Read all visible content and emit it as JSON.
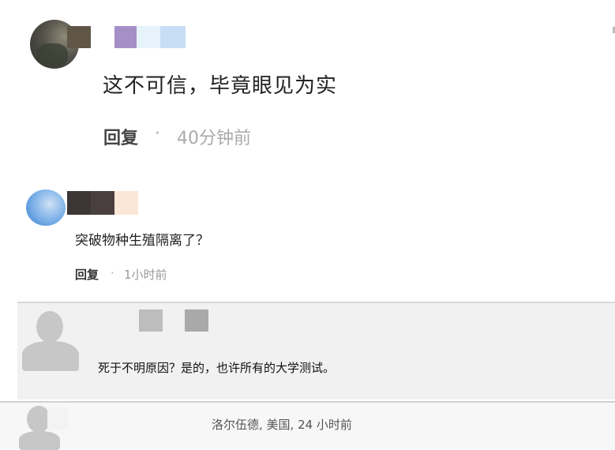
{
  "comments": [
    {
      "text": "这不可信，毕竟眼见为实",
      "reply_label": "回复",
      "separator": "·",
      "time": "40分钟前",
      "username_colors": [
        "#5f5647",
        "#a58fc7",
        "#e6f3fb",
        "#c7def5"
      ]
    },
    {
      "text": "突破物种生殖隔离了？",
      "reply_label": "回复",
      "separator": "·",
      "time": "1小时前",
      "username_colors": [
        "#3c3636",
        "#4a3f3f",
        "#fbe7d8"
      ]
    },
    {
      "text": "死于不明原因？是的，也许所有的大学测试。",
      "username_colors": [
        "#f0f0f0",
        "#bdbdbd",
        "#a9a9a9"
      ]
    },
    {
      "meta": "洛尔伍德, 美国, 24 小时前"
    }
  ]
}
